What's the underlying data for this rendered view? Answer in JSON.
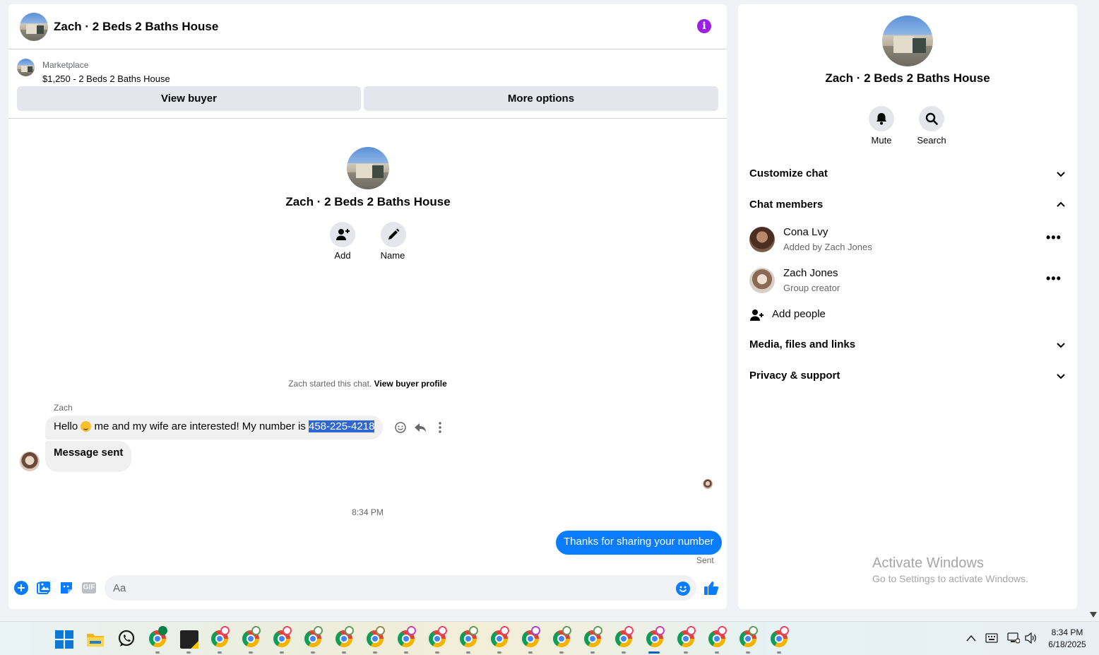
{
  "chat": {
    "title": "Zach · 2 Beds 2 Baths House",
    "marketplace": {
      "label": "Marketplace",
      "listing": "$1,250 - 2 Beds 2 Baths House",
      "view_buyer": "View buyer",
      "more_options": "More options"
    },
    "profile": {
      "title": "Zach · 2 Beds 2 Baths House",
      "add_label": "Add",
      "name_label": "Name"
    },
    "started_text": "Zach started this chat.",
    "view_buyer_profile": "View buyer profile",
    "messages": {
      "sender": "Zach",
      "msg1_a": "Hello",
      "msg1_b": "me and my wife are interested!  My number is",
      "msg1_number": "458-225-4218",
      "msg2": "Message sent",
      "time": "8:34 PM",
      "outgoing": "Thanks for sharing your number",
      "status": "Sent"
    },
    "composer": {
      "placeholder": "Aa",
      "gif": "GIF"
    }
  },
  "info": {
    "title": "Zach · 2 Beds 2 Baths House",
    "mute": "Mute",
    "search": "Search",
    "customize": "Customize chat",
    "members_header": "Chat members",
    "members": [
      {
        "name": "Cona Lvy",
        "sub": "Added by Zach Jones"
      },
      {
        "name": "Zach Jones",
        "sub": "Group creator"
      }
    ],
    "add_people": "Add people",
    "media": "Media, files and links",
    "privacy": "Privacy & support"
  },
  "watermark": {
    "line1": "Activate Windows",
    "line2": "Go to Settings to activate Windows."
  },
  "taskbar": {
    "time": "8:34 PM",
    "date": "6/18/2025"
  },
  "colors": {
    "accent": "#0a7cff",
    "info": "#9b1fe6",
    "highlight": "#2e67d1"
  }
}
